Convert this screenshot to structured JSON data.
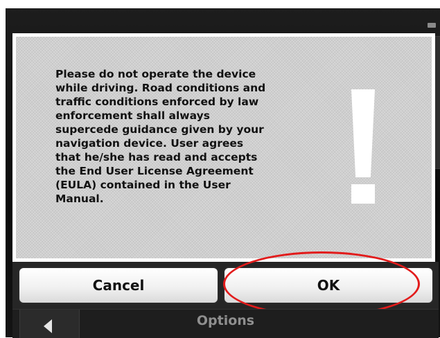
{
  "dialog": {
    "message": "Please do not operate the device\nwhile driving. Road conditions and\ntraffic conditions enforced by law\nenforcement shall always\nsupercede guidance given by your\nnavigation device. User agrees\nthat he/she has read and accepts\nthe End User License Agreement\n(EULA) contained in the User\nManual.",
    "icon": "exclamation-icon",
    "buttons": {
      "cancel_label": "Cancel",
      "ok_label": "OK"
    }
  },
  "nav": {
    "back_icon": "left-arrow-icon",
    "title": "Options"
  },
  "colors": {
    "highlight": "#e21b1b",
    "dialog_bg": "#cfcfcf",
    "device_bg": "#121212"
  }
}
